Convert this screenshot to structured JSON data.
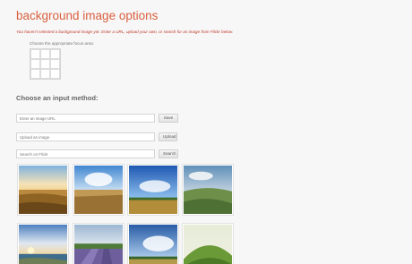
{
  "page": {
    "title": "background image options",
    "notice": "You haven't selected a background image yet. Enter a URL, upload your own, or search for an image from Flickr below.",
    "focus_label": "Choose the appropriate focus area:",
    "method_heading": "Choose an input method:"
  },
  "inputs": {
    "url": {
      "placeholder": "Enter an image URL",
      "button": "Save"
    },
    "upload": {
      "placeholder": "Upload an image",
      "button": "Upload"
    },
    "search": {
      "placeholder": "Search on Flickr",
      "button": "Search"
    }
  },
  "thumbnails": [
    {
      "scene": "wheat-field-sunset"
    },
    {
      "scene": "wheat-field-sky"
    },
    {
      "scene": "field-blue-sky"
    },
    {
      "scene": "hills-clouds"
    },
    {
      "scene": "coast-sunrise"
    },
    {
      "scene": "lavender-field"
    },
    {
      "scene": "field-cloudy-sky"
    },
    {
      "scene": "green-hill"
    }
  ],
  "colors": {
    "title": "#d9603f",
    "notice": "#c0392b",
    "background": "#f7f7f7"
  }
}
